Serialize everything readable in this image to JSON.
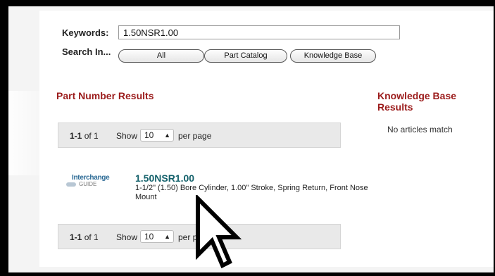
{
  "search": {
    "keywords_label": "Keywords:",
    "keywords_value": "1.50NSR1.00",
    "search_in_label": "Search In...",
    "scope_buttons": [
      "All",
      "Part Catalog",
      "Knowledge Base"
    ]
  },
  "part_results": {
    "heading": "Part Number Results",
    "pager_top": {
      "range": "1-1",
      "of": "of 1",
      "show": "Show",
      "per_page_value": "10",
      "per_page_label": "per page"
    },
    "pager_bottom": {
      "range": "1-1",
      "of": "of 1",
      "show": "Show",
      "per_page_value": "10",
      "per_page_label": "per page"
    },
    "items": [
      {
        "logo_line1": "Interchange",
        "logo_line2": "GUIDE",
        "part_number": "1.50NSR1.00",
        "description": "1-1/2\" (1.50) Bore Cylinder, 1.00\" Stroke, Spring Return, Front Nose Mount"
      }
    ]
  },
  "kb_results": {
    "heading": "Knowledge Base Results",
    "empty_message": "No articles match"
  },
  "icons": {
    "cursor": "pointer-hand-cursor-icon",
    "select_arrows": "updown-arrows-icon",
    "logo": "interchange-guide-logo-icon"
  },
  "colors": {
    "heading": "#9b1b1b",
    "part_link": "#14616b",
    "pager_bg": "#e9e9e9"
  }
}
